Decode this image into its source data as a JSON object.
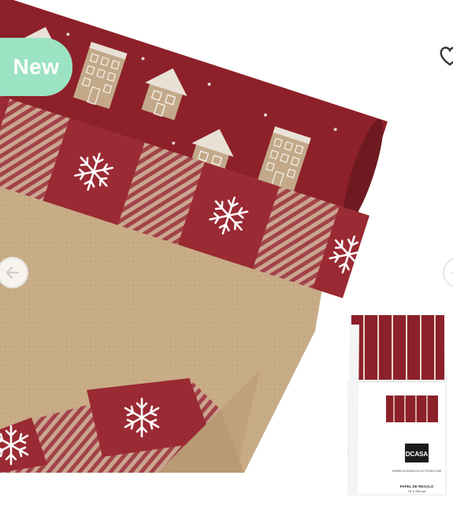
{
  "product": {
    "badge": "New",
    "box_logo": "DCASA",
    "box_url": "WWW.DCASACOLLECTION.COM",
    "box_line1": "PAPEL DE REGALO",
    "box_line2": "70 X 200 cm"
  },
  "colors": {
    "badge_bg": "#9be3c3",
    "wrap_red": "#8d2129",
    "kraft": "#c8ac86"
  },
  "icons": {
    "prev": "arrow-left-icon",
    "wishlist": "heart-icon"
  }
}
